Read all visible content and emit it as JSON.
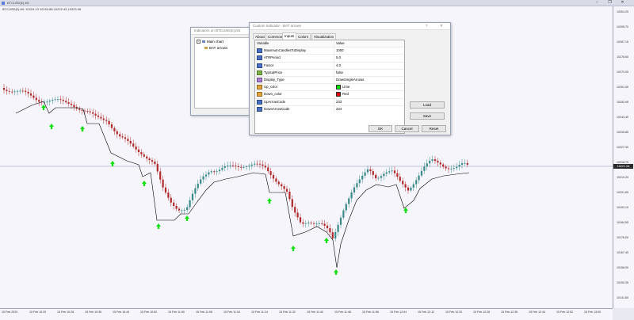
{
  "window": {
    "title": "BTCUSD(£),M1"
  },
  "chart": {
    "info": "BTCUSD(£),M1  10224.13 10224.88 10222.43 10223.06",
    "current_price": "10221.06",
    "y_labels": [
      "10304.25",
      "10295.70",
      "10287.15",
      "10278.60",
      "10270.05",
      "10261.50",
      "10252.95",
      "10244.40",
      "10235.85",
      "10227.30",
      "10218.75",
      "10210.20",
      "10201.65",
      "10193.10",
      "10184.55",
      "10176.00",
      "10167.45",
      "10158.90",
      "10150.35",
      "10141.80"
    ],
    "x_labels": [
      "15 Feb 2020",
      "15 Feb 10:20",
      "15 Feb 10:28",
      "15 Feb 10:36",
      "15 Feb 10:44",
      "15 Feb 10:52",
      "15 Feb 11:00",
      "15 Feb 11:08",
      "15 Feb 11:16",
      "15 Feb 11:24",
      "15 Feb 11:32",
      "15 Feb 11:40",
      "15 Feb 11:48",
      "15 Feb 11:56",
      "15 Feb 12:04",
      "15 Feb 12:12",
      "15 Feb 12:20",
      "15 Feb 12:28",
      "15 Feb 12:36",
      "15 Feb 12:44",
      "15 Feb 12:52",
      "15 Feb 13:00"
    ],
    "colors": {
      "bull": "#3a8a8a",
      "bear": "#b02a2a",
      "arrow": "#14e014",
      "line": "#000000"
    }
  },
  "indicators_window": {
    "title": "Indicators on BTCUSD(£),M1",
    "tree": {
      "root": "Main chart",
      "child": "BAT arrows"
    }
  },
  "dialog": {
    "title": "Custom Indicator - BAT arrows",
    "help": "?",
    "close": "✕",
    "tabs": [
      "About",
      "Common",
      "Inputs",
      "Colors",
      "Visualization"
    ],
    "active_tab": "Inputs",
    "headers": {
      "variable": "Variable",
      "value": "Value"
    },
    "rows": [
      {
        "name": "MaximumCandlesToDisplay",
        "value": "1000"
      },
      {
        "name": "ATRPeriod",
        "value": "5.0"
      },
      {
        "name": "Factor",
        "value": "4.0"
      },
      {
        "name": "TypicalPrice",
        "value": "false"
      },
      {
        "name": "Display_Type",
        "value": "DrawSingleArrows"
      },
      {
        "name": "Up_color",
        "value": "Lime",
        "color": "#00e600"
      },
      {
        "name": "Down_color",
        "value": "Red",
        "color": "#e00000"
      },
      {
        "name": "UpArrowCode",
        "value": "233"
      },
      {
        "name": "DownArrowCode",
        "value": "234"
      }
    ],
    "buttons": {
      "load": "Load",
      "save": "Save",
      "ok": "OK",
      "cancel": "Cancel",
      "reset": "Reset"
    }
  }
}
